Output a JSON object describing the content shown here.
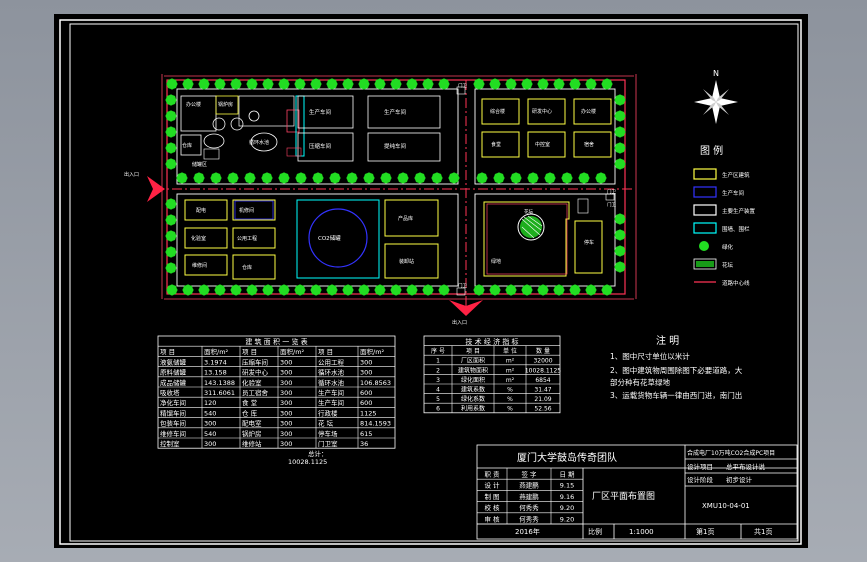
{
  "drawing": {
    "north_label": "N",
    "site_plan": {
      "buildings_top_left": [
        {
          "label": "办公楼"
        },
        {
          "label": "锅炉房"
        },
        {
          "label": "仓库"
        },
        {
          "label": "循环水池"
        },
        {
          "label": "储罐区"
        },
        {
          "label": "生产车间"
        },
        {
          "label": "压缩车间"
        },
        {
          "label": "生产车间"
        },
        {
          "label": "提纯车间"
        }
      ],
      "buildings_top_right": [
        {
          "label": "综合楼"
        },
        {
          "label": "研发中心"
        },
        {
          "label": "办公楼"
        },
        {
          "label": "食堂"
        },
        {
          "label": "中控室"
        },
        {
          "label": "宿舍"
        }
      ],
      "buildings_bottom_left": [
        {
          "label": "配电"
        },
        {
          "label": "化验室"
        },
        {
          "label": "维修间"
        },
        {
          "label": "机修间"
        },
        {
          "label": "控制间"
        },
        {
          "label": "公用工程"
        },
        {
          "label": "仓库"
        }
      ],
      "buildings_bottom_middle": [
        {
          "label": "CO2储罐"
        },
        {
          "label": "产品库"
        },
        {
          "label": "装卸站"
        }
      ],
      "buildings_bottom_right": [
        {
          "label": "花坛"
        },
        {
          "label": "绿地"
        },
        {
          "label": "停车"
        },
        {
          "label": "门卫"
        }
      ],
      "gate_labels": [
        "门卫",
        "门卫",
        "门卫",
        "门卫"
      ],
      "entrance_labels": [
        "出入口",
        "出入口"
      ]
    },
    "legend": {
      "title": "图  例",
      "items": [
        {
          "label": "生产区建筑",
          "color": "#ffff44"
        },
        {
          "label": "生产车间",
          "color": "#3333ff"
        },
        {
          "label": "主要生产装置",
          "color": "#ffffff"
        },
        {
          "label": "围墙、围栏",
          "color": "#00ffff"
        },
        {
          "label": "绿化",
          "color": "#22dd22"
        },
        {
          "label": "花坛",
          "color": "#22dd22"
        },
        {
          "label": "道路中心线",
          "color": "#ff3355"
        }
      ]
    },
    "building_table": {
      "title": "建  筑  面  积  一  览  表",
      "headers": [
        "项  目",
        "面积/m²",
        "项  目",
        "面积/m²",
        "项  目",
        "面积/m²"
      ],
      "rows": [
        [
          "液氨储罐",
          "3.1974",
          "压缩车间",
          "300",
          "公用工程",
          "300"
        ],
        [
          "原料储罐",
          "13.158",
          "研发中心",
          "300",
          "循环水池",
          "300"
        ],
        [
          "成品储罐",
          "143.1388",
          "化验室",
          "300",
          "循环水池",
          "106.8563"
        ],
        [
          "吸收塔",
          "311.6061",
          "员工宿舍",
          "300",
          "生产车间",
          "600"
        ],
        [
          "净化车间",
          "120",
          "食  堂",
          "300",
          "生产车间",
          "600"
        ],
        [
          "精馏车间",
          "540",
          "仓  库",
          "300",
          "行政楼",
          "1125"
        ],
        [
          "包装车间",
          "300",
          "配电室",
          "300",
          "花  坛",
          "814.1593"
        ],
        [
          "维修车间",
          "540",
          "锅炉房",
          "300",
          "停车场",
          "615"
        ],
        [
          "控制室",
          "300",
          "维修站",
          "300",
          "门卫室",
          "36"
        ]
      ],
      "total_label": "总计：",
      "total_value": "10028.1125"
    },
    "tech_table": {
      "title": "技  术  经  济  指  标",
      "headers": [
        "序  号",
        "项  目",
        "单  位",
        "数  量"
      ],
      "rows": [
        [
          "1",
          "厂区面积",
          "m²",
          "32000"
        ],
        [
          "2",
          "建筑物面积",
          "m²",
          "10028.1125"
        ],
        [
          "3",
          "绿化面积",
          "m²",
          "6854"
        ],
        [
          "4",
          "建筑系数",
          "%",
          "31.47"
        ],
        [
          "5",
          "绿化系数",
          "%",
          "21.09"
        ],
        [
          "6",
          "利用系数",
          "%",
          "52.56"
        ]
      ]
    },
    "notes": {
      "title": "注  明",
      "lines": [
        "1、图中尺寸单位以米计",
        "2、图中建筑物周围除图下必要道路，大",
        "   部分种有花草绿地",
        "3、运载货物车辆一律由西门进，南门出"
      ]
    },
    "title_block": {
      "company": "厦门大学鼓岛传奇团队",
      "project_name": "合成电厂10万吨CO2合成PC项目",
      "design_item_label": "设计项目",
      "design_item_value": "总平布设计说",
      "design_stage_label": "设计阶段",
      "design_stage_value": "初步设计",
      "drawing_no": "XMU10-04-01",
      "drawing_title": "厂区平面布置图",
      "sig_headers": [
        "职  责",
        "签  字",
        "日  期"
      ],
      "sig_rows": [
        [
          "设  计",
          "燕建鹏",
          "9.15"
        ],
        [
          "制  图",
          "燕建鹏",
          "9.16"
        ],
        [
          "校  核",
          "何秀秀",
          "9.20"
        ],
        [
          "审  核",
          "何秀秀",
          "9.20"
        ]
      ],
      "year": "2016年",
      "scale_label": "比例",
      "scale_value": "1:1000",
      "sheet_label": "第1页",
      "total_sheets_label": "共1页"
    }
  }
}
